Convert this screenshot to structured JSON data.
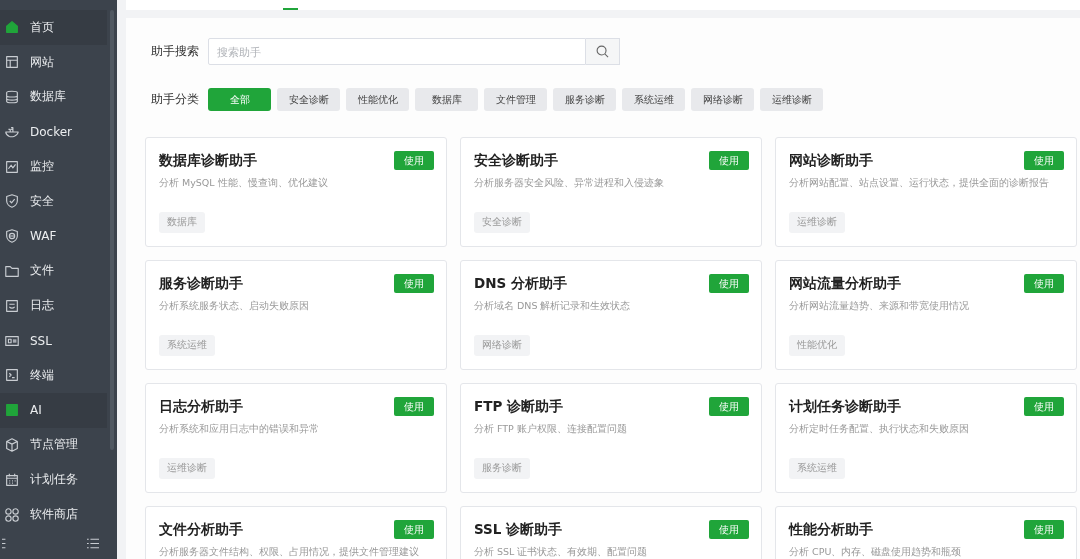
{
  "sidebar": {
    "items": [
      {
        "label": "首页",
        "selected": true
      },
      {
        "label": "网站",
        "selected": false
      },
      {
        "label": "数据库",
        "selected": false
      },
      {
        "label": "Docker",
        "selected": false
      },
      {
        "label": "监控",
        "selected": false
      },
      {
        "label": "安全",
        "selected": false
      },
      {
        "label": "WAF",
        "selected": false
      },
      {
        "label": "文件",
        "selected": false
      },
      {
        "label": "日志",
        "selected": false
      },
      {
        "label": "SSL",
        "selected": false
      },
      {
        "label": "终端",
        "selected": false
      },
      {
        "label": "AI",
        "selected": true
      },
      {
        "label": "节点管理",
        "selected": false
      },
      {
        "label": "计划任务",
        "selected": false
      },
      {
        "label": "软件商店",
        "selected": false
      }
    ]
  },
  "search": {
    "label": "助手搜索",
    "placeholder": "搜索助手"
  },
  "categories": {
    "label": "助手分类",
    "items": [
      {
        "label": "全部",
        "selected": true
      },
      {
        "label": "安全诊断",
        "selected": false
      },
      {
        "label": "性能优化",
        "selected": false
      },
      {
        "label": "数据库",
        "selected": false
      },
      {
        "label": "文件管理",
        "selected": false
      },
      {
        "label": "服务诊断",
        "selected": false
      },
      {
        "label": "系统运维",
        "selected": false
      },
      {
        "label": "网络诊断",
        "selected": false
      },
      {
        "label": "运维诊断",
        "selected": false
      }
    ]
  },
  "assistants": [
    {
      "title": "数据库诊断助手",
      "button": "使用",
      "description": "分析 MySQL 性能、慢查询、优化建议",
      "tag": "数据库"
    },
    {
      "title": "安全诊断助手",
      "button": "使用",
      "description": "分析服务器安全风险、异常进程和入侵迹象",
      "tag": "安全诊断"
    },
    {
      "title": "网站诊断助手",
      "button": "使用",
      "description": "分析网站配置、站点设置、运行状态，提供全面的诊断报告",
      "tag": "运维诊断"
    },
    {
      "title": "服务诊断助手",
      "button": "使用",
      "description": "分析系统服务状态、启动失败原因",
      "tag": "系统运维"
    },
    {
      "title": "DNS 分析助手",
      "button": "使用",
      "description": "分析域名 DNS 解析记录和生效状态",
      "tag": "网络诊断"
    },
    {
      "title": "网站流量分析助手",
      "button": "使用",
      "description": "分析网站流量趋势、来源和带宽使用情况",
      "tag": "性能优化"
    },
    {
      "title": "日志分析助手",
      "button": "使用",
      "description": "分析系统和应用日志中的错误和异常",
      "tag": "运维诊断"
    },
    {
      "title": "FTP 诊断助手",
      "button": "使用",
      "description": "分析 FTP 账户权限、连接配置问题",
      "tag": "服务诊断"
    },
    {
      "title": "计划任务诊断助手",
      "button": "使用",
      "description": "分析定时任务配置、执行状态和失败原因",
      "tag": "系统运维"
    },
    {
      "title": "文件分析助手",
      "button": "使用",
      "description": "分析服务器文件结构、权限、占用情况，提供文件管理建议"
    },
    {
      "title": "SSL 诊断助手",
      "button": "使用",
      "description": "分析 SSL 证书状态、有效期、配置问题"
    },
    {
      "title": "性能分析助手",
      "button": "使用",
      "description": "分析 CPU、内存、磁盘使用趋势和瓶颈"
    }
  ]
}
